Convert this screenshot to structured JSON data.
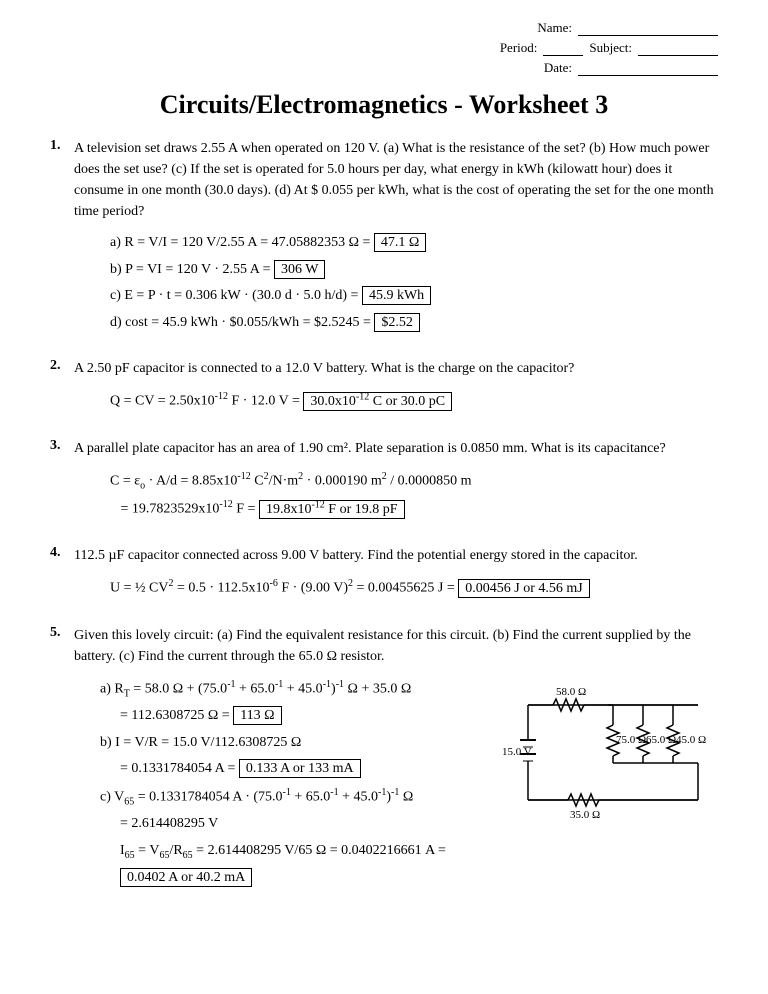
{
  "header": {
    "name_label": "Name:",
    "period_label": "Period:",
    "subject_label": "Subject:",
    "date_label": "Date:"
  },
  "title": "Circuits/Electromagnetics - Worksheet 3",
  "problems": [
    {
      "number": "1.",
      "text": "A television set draws 2.55 A when operated on 120 V.  (a)  What is the resistance of the set?  (b)  How much power does the set use?  (c)  If the set is operated for 5.0 hours per day, what energy in kWh (kilowatt hour) does it consume in one month (30.0 days).  (d)  At $ 0.055 per kWh, what is the cost of operating the set for the one month time period?"
    },
    {
      "number": "2.",
      "text": "A 2.50 pF capacitor is connected to a 12.0 V battery.  What is the charge on the capacitor?"
    },
    {
      "number": "3.",
      "text": "A parallel plate capacitor has an area of 1.90 cm². Plate separation is 0.0850 mm.  What is its capacitance?"
    },
    {
      "number": "4.",
      "text": "112.5 µF capacitor connected across 9.00 V battery.  Find the potential energy stored in the capacitor."
    },
    {
      "number": "5.",
      "text": "Given this lovely circuit:  (a) Find the equivalent resistance for this circuit. (b) Find the current supplied by the battery.  (c)  Find the current through the 65.0 Ω resistor."
    }
  ],
  "answers": {
    "p1a": "47.1 Ω",
    "p1b": "306 W",
    "p1c": "45.9 kWh",
    "p1d": "$2.52",
    "p2": "30.0x10⁻¹² C or 30.0 pC",
    "p3": "19.8x10⁻¹² F or 19.8 pF",
    "p4": "0.00456 J or 4.56 mJ",
    "p5a": "113 Ω",
    "p5b": "0.133 A or 133 mA",
    "p5c": "0.0402 A or 40.2 mA"
  },
  "circuit": {
    "battery_voltage": "15.0 V",
    "r1": "58.0 Ω",
    "r2": "75.0 Ω",
    "r3": "45.0 Ω",
    "r4": "65.0 Ω",
    "r5": "35.0 Ω"
  }
}
